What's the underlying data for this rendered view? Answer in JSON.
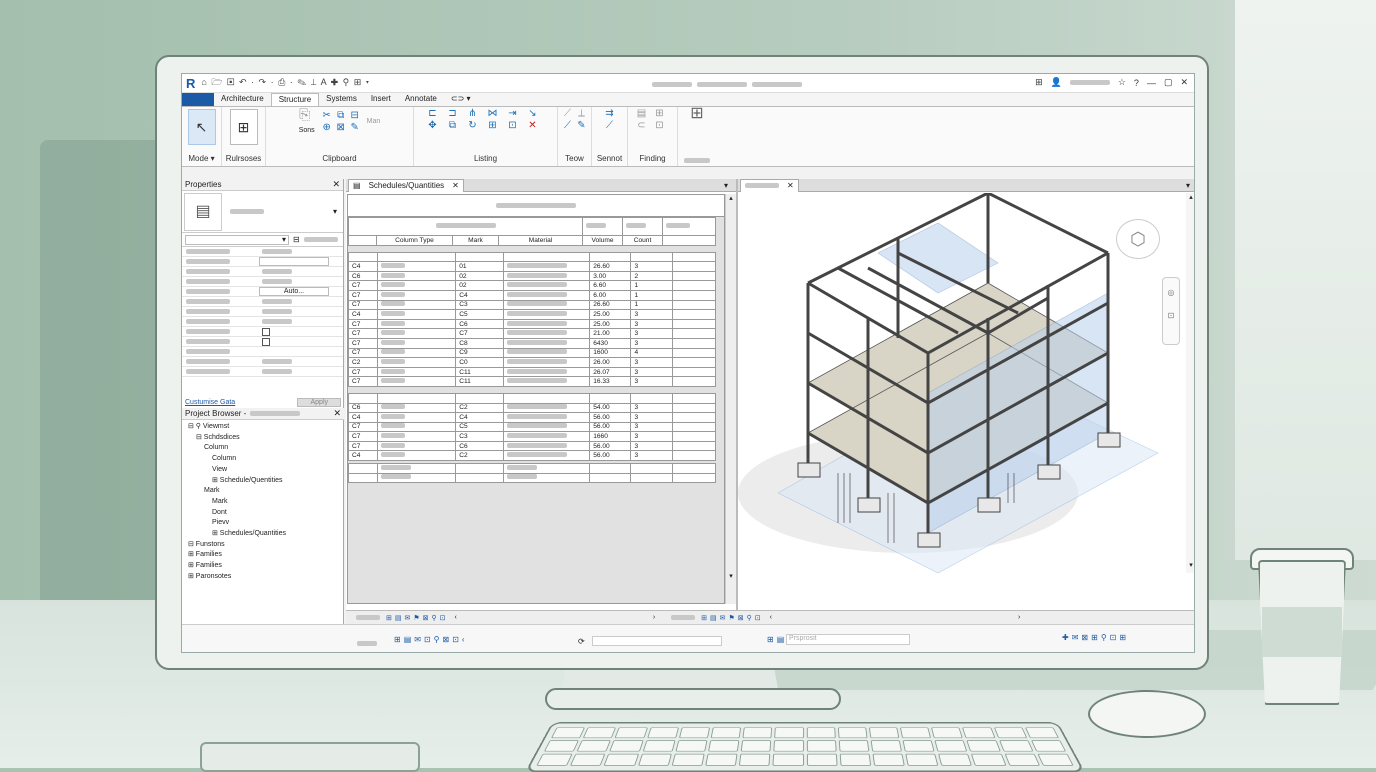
{
  "app": {
    "logo": "R",
    "quick_access": "⌂ 🗁 ▣ ↶ · ↷ · ⎙ · ✎ ⟂ A ✚ ⚲ ⊞ ▾",
    "title_right": {
      "account_icon": "user-icon",
      "star": "☆",
      "help": "?",
      "win_controls": [
        "—",
        "▢",
        "✕"
      ]
    }
  },
  "ribbon": {
    "tabs": [
      "Architecture",
      "Structure",
      "Systems",
      "Insert",
      "Annotate",
      "⊂⊃ ▾"
    ],
    "active_tab": "Structure",
    "panels": [
      {
        "label": "Mode ▾",
        "big": "↖"
      },
      {
        "label": "Rulrsoses",
        "big": "⊞"
      },
      {
        "label": "Clipboard",
        "items": [
          "Sons",
          "Man"
        ]
      },
      {
        "label": "Listing"
      },
      {
        "label": "Teow"
      },
      {
        "label": "Sennot"
      },
      {
        "label": "Finding"
      }
    ]
  },
  "properties": {
    "title": "Properties",
    "apply": "Apply",
    "link": "Custumise Gata",
    "auto_value": "Auto..."
  },
  "project_browser": {
    "title": "Project Browser -",
    "items": [
      "⊟ ⚲ Viewmst",
      "⊟ Schdsdices",
      "Column",
      "Column",
      "View",
      "⊞ Schedule/Quentities",
      "Mark",
      "Mark",
      "Dont",
      "Pievv",
      "⊞ Schedules/Quantities",
      "⊟ Funstons",
      "⊞ Families",
      "⊞ Families",
      "⊞ Paronsotes"
    ]
  },
  "schedule": {
    "tab": "Schedules/Quantities",
    "headers": [
      "",
      "Column Type",
      "Mark",
      "Material",
      "Volume",
      "Count"
    ],
    "rows1": [
      [
        "C4",
        "01",
        "26.60",
        "3"
      ],
      [
        "C6",
        "02",
        "3.00",
        "2"
      ],
      [
        "C7",
        "02",
        "6.60",
        "1"
      ],
      [
        "C7",
        "C4",
        "6.00",
        "1"
      ],
      [
        "C7",
        "C3",
        "26.60",
        "1"
      ],
      [
        "C4",
        "C5",
        "25.00",
        "3"
      ],
      [
        "C7",
        "C6",
        "25.00",
        "3"
      ],
      [
        "C7",
        "C7",
        "21.00",
        "3"
      ],
      [
        "C7",
        "C8",
        "6430",
        "3"
      ],
      [
        "C7",
        "C9",
        "1600",
        "4"
      ],
      [
        "C2",
        "C0",
        "26.00",
        "3"
      ],
      [
        "C7",
        "C11",
        "26.07",
        "3"
      ],
      [
        "C7",
        "C11",
        "16.33",
        "3"
      ]
    ],
    "rows2": [
      [
        "C6",
        "C2",
        "54.00",
        "3"
      ],
      [
        "C4",
        "C4",
        "56.00",
        "3"
      ],
      [
        "C7",
        "C5",
        "56.00",
        "3"
      ],
      [
        "C7",
        "C3",
        "1660",
        "3"
      ],
      [
        "C7",
        "C6",
        "56.00",
        "3"
      ],
      [
        "C4",
        "C2",
        "56.00",
        "3"
      ]
    ]
  },
  "view3d": {
    "viewcube": "cube-icon",
    "status_text": "Prsprosit"
  },
  "colors": {
    "accent": "#1c5aa6",
    "steel": "#5a5a5a",
    "glass": "#8fb3dc"
  }
}
